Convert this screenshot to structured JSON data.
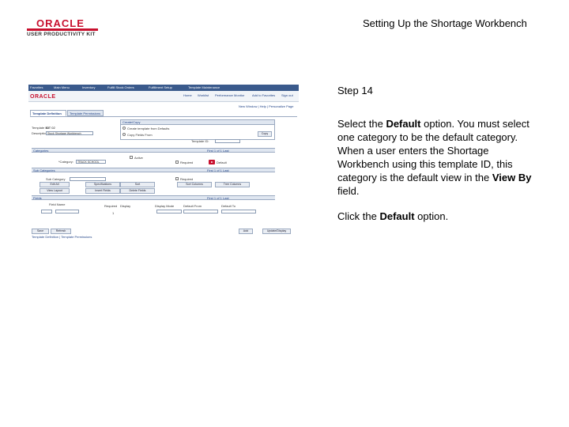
{
  "logo": {
    "wordmark": "ORACLE",
    "subtitle": "USER PRODUCTIVITY KIT"
  },
  "header": {
    "title": "Setting Up the Shortage Workbench"
  },
  "instructions": {
    "step_label": "Step 14",
    "para1": [
      {
        "text": "Select the ",
        "bold": false
      },
      {
        "text": "Default",
        "bold": true
      },
      {
        "text": " option. You must select one category to be the default category. When a user enters the Shortage Workbench using this template ID, this category is the default view in the ",
        "bold": false
      },
      {
        "text": "View By",
        "bold": true
      },
      {
        "text": " field.",
        "bold": false
      }
    ],
    "para2": [
      {
        "text": "Click the ",
        "bold": false
      },
      {
        "text": "Default",
        "bold": true
      },
      {
        "text": " option.",
        "bold": false
      }
    ]
  },
  "screenshot": {
    "nav_items": [
      "Favorites",
      "Main Menu",
      "Inventory",
      "Fulfill Stock Orders",
      "Fulfillment Setup",
      "Template Maintenance"
    ],
    "brand": "ORACLE",
    "brand_links": [
      "Home",
      "Worklist",
      "Performance Monitor",
      "Add to Favorites",
      "Sign out"
    ],
    "tabs": [
      "Template Definition",
      "Template Permissions"
    ],
    "fields": {
      "template_id_label": "Template ID:",
      "template_id_value": "KIT 02",
      "description_label": "Description:",
      "description_value": "Stock Shortage Workbench",
      "create_group_label": "Create/Copy",
      "create_option": "Create template from Defaults",
      "copy_option": "Copy Fields From",
      "template_id2_label": "Template ID:",
      "copy_button": "Copy",
      "category_label": "*Category:",
      "category_value": "TRACK SCHOOL",
      "active_label": "Active",
      "required_label": "Required",
      "default_label": "Default",
      "sub_category_label": "Sub Category",
      "required2_label": "Required"
    },
    "groups": {
      "categories": "Categories",
      "sub_categories": "Sub Categories",
      "grid_label": "Fields"
    },
    "grid_nav": "First 1 of 1 Last",
    "buttons_row1": [
      "Edit All",
      "Specifications",
      "Sort",
      "Sort Columns",
      "Tree Columns"
    ],
    "buttons_row2": [
      "View Layout",
      "Insert Fields",
      "Delete Fields"
    ],
    "grid_columns": [
      "Field Name",
      "Required",
      "Display",
      "Display Mode",
      "Default From",
      "Default To"
    ],
    "grid_row_value": "1",
    "bottom_buttons": [
      "Save",
      "Refresh"
    ],
    "bottom_right_buttons": [
      "Add",
      "Update/Display"
    ],
    "bottom_links": "Template Definition | Template Permissions"
  }
}
